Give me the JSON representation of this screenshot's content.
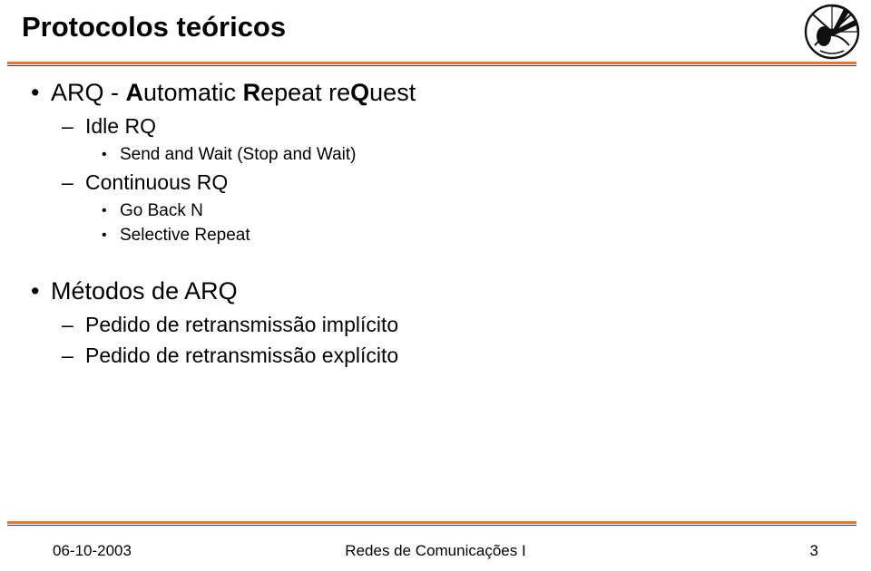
{
  "slide": {
    "title": "Protocolos teóricos",
    "logo_name": "institution-logo",
    "accent_color": "#E8762C",
    "rule_secondary_color": "#2B3A8F",
    "text_color": "#000000",
    "body": [
      {
        "level": 1,
        "bullet": "•",
        "segments": [
          {
            "text": "ARQ - ",
            "bold": false
          },
          {
            "text": "A",
            "bold": true
          },
          {
            "text": "utomatic ",
            "bold": false
          },
          {
            "text": "R",
            "bold": true
          },
          {
            "text": "epeat re",
            "bold": false
          },
          {
            "text": "Q",
            "bold": true
          },
          {
            "text": "uest",
            "bold": false
          }
        ]
      },
      {
        "level": 2,
        "bullet": "–",
        "text": "Idle RQ"
      },
      {
        "level": 3,
        "bullet": "•",
        "text": "Send and Wait (Stop and Wait)"
      },
      {
        "level": 2,
        "bullet": "–",
        "text": "Continuous RQ"
      },
      {
        "level": 3,
        "bullet": "•",
        "text": "Go Back N"
      },
      {
        "level": 3,
        "bullet": "•",
        "text": "Selective Repeat"
      },
      {
        "level": 1,
        "bullet": "•",
        "text": "Métodos de ARQ"
      },
      {
        "level": 2,
        "bullet": "–",
        "text": "Pedido de retransmissão implícito"
      },
      {
        "level": 2,
        "bullet": "–",
        "text": "Pedido de retransmissão explícito"
      }
    ]
  },
  "footer": {
    "date": "06-10-2003",
    "course": "Redes de Comunicações I",
    "page_number": "3"
  }
}
